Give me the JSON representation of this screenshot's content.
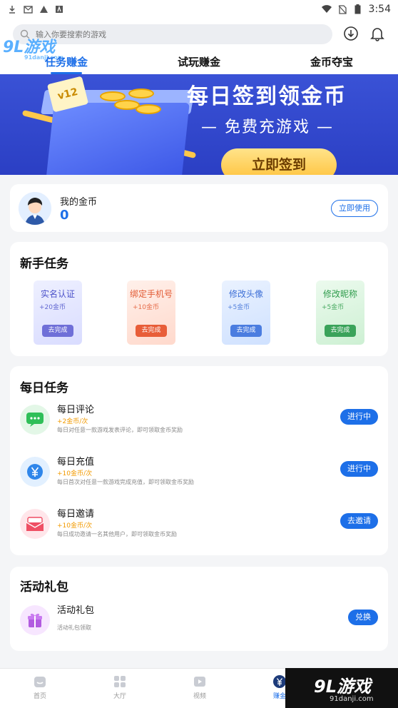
{
  "status_bar": {
    "time": "3:54"
  },
  "logo": {
    "text": "9L游戏",
    "sub": "91danji.com"
  },
  "search": {
    "placeholder": "输入你要搜索的游戏"
  },
  "tabs": [
    {
      "label": "任务赚金",
      "active": true
    },
    {
      "label": "试玩赚金",
      "active": false
    },
    {
      "label": "金币夺宝",
      "active": false
    }
  ],
  "banner": {
    "title": "每日签到领金币",
    "subtitle": "— 免费充游戏 —",
    "button": "立即签到",
    "coupon_text": "v12"
  },
  "coins": {
    "label": "我的金币",
    "value": "0",
    "button": "立即使用"
  },
  "newbie": {
    "title": "新手任务",
    "tasks": [
      {
        "name": "实名认证",
        "reward": "+20金币",
        "button": "去完成"
      },
      {
        "name": "绑定手机号",
        "reward": "+10金币",
        "button": "去完成"
      },
      {
        "name": "修改头像",
        "reward": "+5金币",
        "button": "去完成"
      },
      {
        "name": "修改昵称",
        "reward": "+5金币",
        "button": "去完成"
      }
    ]
  },
  "daily": {
    "title": "每日任务",
    "tasks": [
      {
        "name": "每日评论",
        "reward": "+2金币/次",
        "desc": "每日对任意一款游戏发表评论，即可领取金币奖励",
        "button": "进行中"
      },
      {
        "name": "每日充值",
        "reward": "+10金币/次",
        "desc": "每日首次对任意一款游戏完成充值，即可领取金币奖励",
        "button": "进行中"
      },
      {
        "name": "每日邀请",
        "reward": "+10金币/次",
        "desc": "每日成功邀请一名其他用户，即可领取金币奖励",
        "button": "去邀请"
      }
    ]
  },
  "event": {
    "title": "活动礼包",
    "item": {
      "name": "活动礼包",
      "desc": "活动礼包领取",
      "button": "兑换"
    }
  },
  "bottom_nav": [
    {
      "label": "首页",
      "active": false
    },
    {
      "label": "大厅",
      "active": false
    },
    {
      "label": "视频",
      "active": false
    },
    {
      "label": "赚金",
      "active": true
    }
  ],
  "watermark": {
    "main": "9L游戏",
    "sub": "91danji.com"
  },
  "colors": {
    "accent": "#1d6fe8",
    "reward": "#f29a00"
  }
}
